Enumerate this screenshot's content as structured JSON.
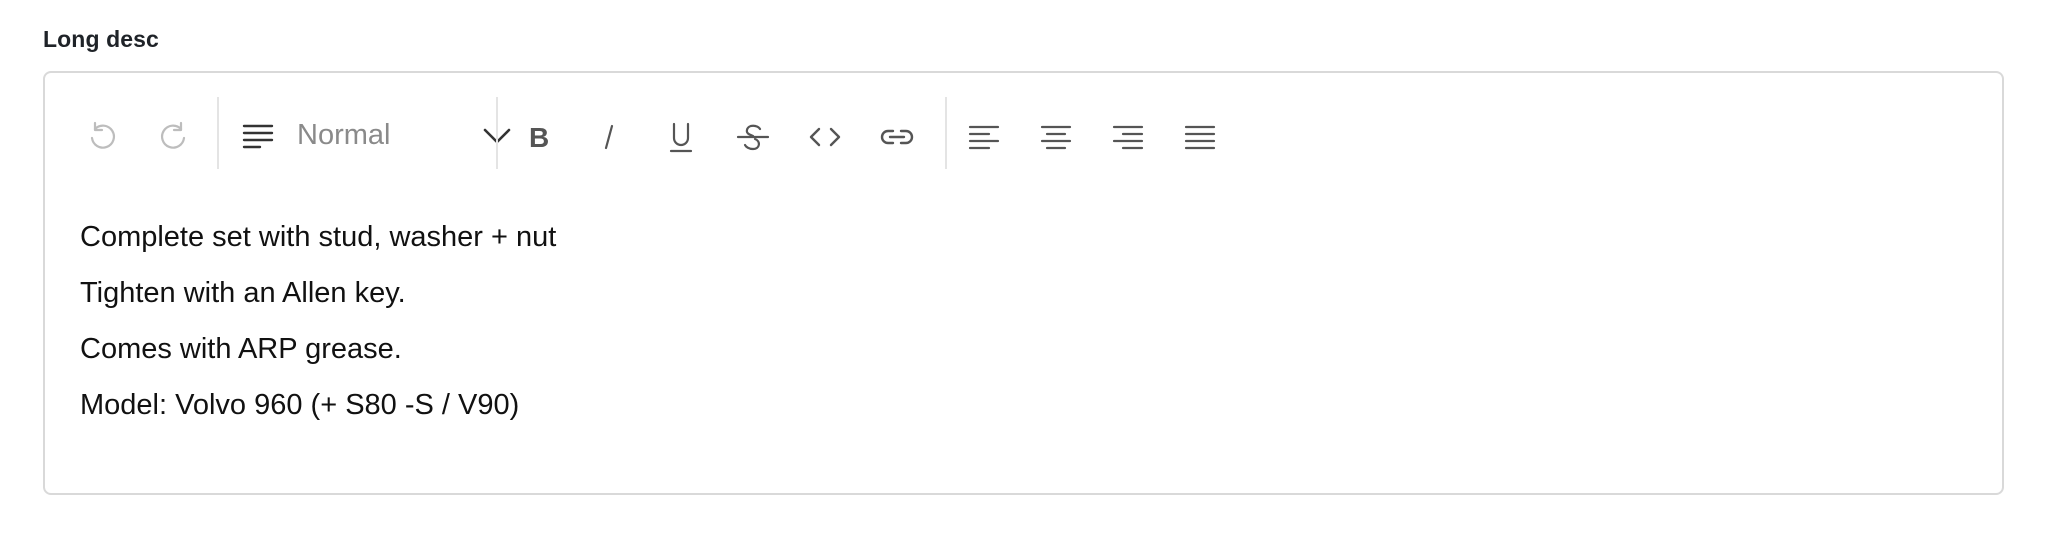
{
  "field": {
    "label": "Long desc"
  },
  "toolbar": {
    "undo": {
      "icon": "undo-icon",
      "disabled": true
    },
    "redo": {
      "icon": "redo-icon",
      "disabled": true
    },
    "block_format": {
      "icon": "paragraph-lines-icon",
      "value": "Normal"
    },
    "formatting": [
      {
        "name": "bold",
        "icon": "bold-icon"
      },
      {
        "name": "italic",
        "icon": "italic-icon"
      },
      {
        "name": "underline",
        "icon": "underline-icon"
      },
      {
        "name": "strikethrough",
        "icon": "strikethrough-icon"
      },
      {
        "name": "code",
        "icon": "code-icon"
      },
      {
        "name": "link",
        "icon": "link-icon"
      }
    ],
    "alignment": [
      {
        "name": "left",
        "icon": "align-left-icon"
      },
      {
        "name": "center",
        "icon": "align-center-icon"
      },
      {
        "name": "right",
        "icon": "align-right-icon"
      },
      {
        "name": "justify",
        "icon": "align-justify-icon"
      }
    ]
  },
  "content": {
    "paragraphs": [
      "Complete set with stud, washer + nut",
      "Tighten with an Allen key.",
      "Comes with ARP grease.",
      "Model: Volvo 960 (+ S80 -S / V90)"
    ]
  },
  "colors": {
    "border": "#d9d9d9",
    "icon": "#555555",
    "icon_disabled": "#bdbdbd",
    "placeholder": "#8a8a8a"
  }
}
